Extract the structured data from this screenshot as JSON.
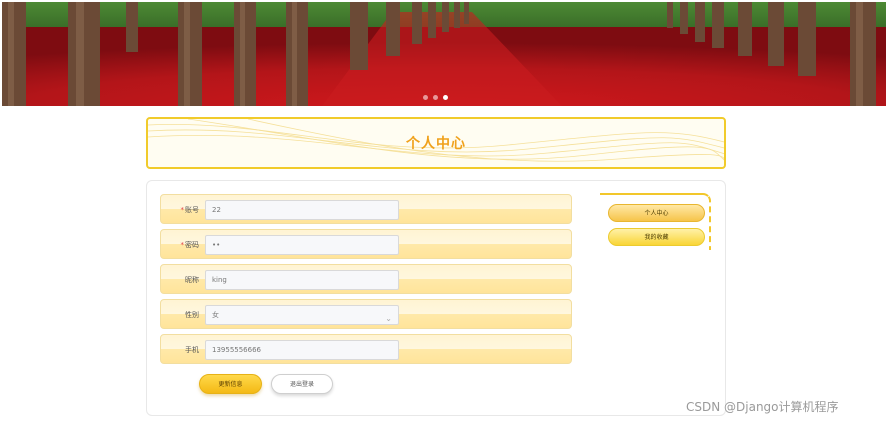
{
  "header": {
    "carousel_dots": 3,
    "active_dot_index": 2
  },
  "page": {
    "title": "个人中心"
  },
  "form": {
    "fields": [
      {
        "label": "账号",
        "required": true,
        "value": "22"
      },
      {
        "label": "密码",
        "required": true,
        "value": "••"
      },
      {
        "label": "昵称",
        "required": false,
        "value": "king"
      },
      {
        "label": "性别",
        "required": false,
        "value": "女",
        "type": "select"
      },
      {
        "label": "手机",
        "required": false,
        "value": "13955556666"
      }
    ],
    "required_mark": "*",
    "update_button": "更新信息",
    "logout_button": "退出登录"
  },
  "side_menu": {
    "items": [
      {
        "label": "个人中心",
        "active": true
      },
      {
        "label": "我的收藏",
        "active": false
      }
    ]
  },
  "watermark": "CSDN @Django计算机程序",
  "colors": {
    "accent": "#f0a11b",
    "border_yellow": "#f1cb2b",
    "row_fill": "#ffe9a9",
    "required": "#e23c3c"
  },
  "icons": {
    "select_arrow": "chevron-down-icon"
  }
}
